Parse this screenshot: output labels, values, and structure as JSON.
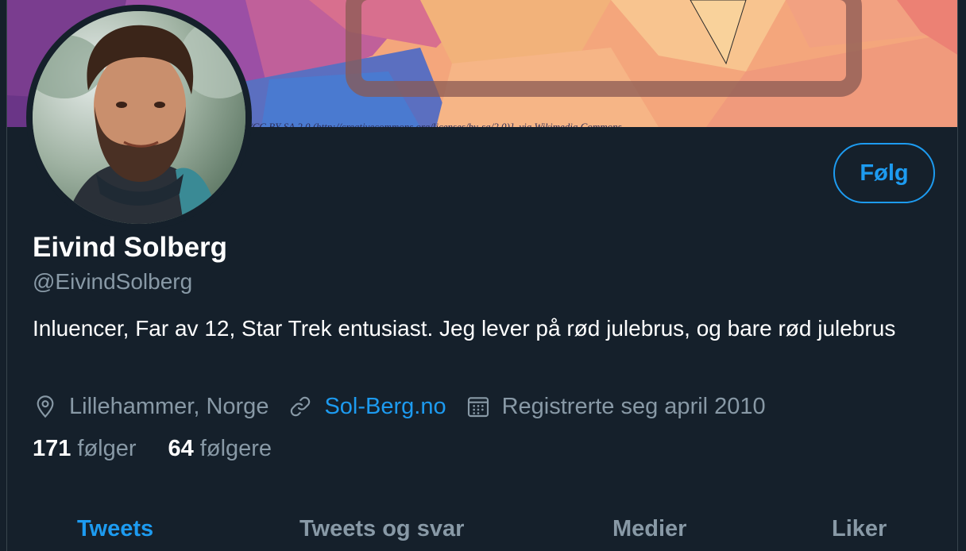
{
  "banner": {
    "attribution": "/CC BY-SA 2.0 (http://creativecommons.org/licenses/by-sa/2.0)], via Wikimedia Commons"
  },
  "profile": {
    "name": "Eivind Solberg",
    "handle": "@EivindSolberg",
    "bio": "Inluencer, Far av 12, Star Trek entusiast. Jeg lever på rød julebrus, og bare rød julebrus",
    "location": "Lillehammer, Norge",
    "website": "Sol-Berg.no",
    "joined": "Registrerte seg april 2010",
    "following_count": "171",
    "following_label": "følger",
    "followers_count": "64",
    "followers_label": "følgere"
  },
  "actions": {
    "follow_label": "Følg"
  },
  "tabs": [
    {
      "label": "Tweets",
      "active": true
    },
    {
      "label": "Tweets og svar",
      "active": false
    },
    {
      "label": "Medier",
      "active": false
    },
    {
      "label": "Liker",
      "active": false
    }
  ],
  "icons": {
    "location": "map-pin-icon",
    "website": "link-icon",
    "joined": "calendar-icon"
  },
  "colors": {
    "background": "#15202b",
    "accent": "#1d9bf0",
    "secondary_text": "#8899a6",
    "primary_text": "#ffffff"
  }
}
